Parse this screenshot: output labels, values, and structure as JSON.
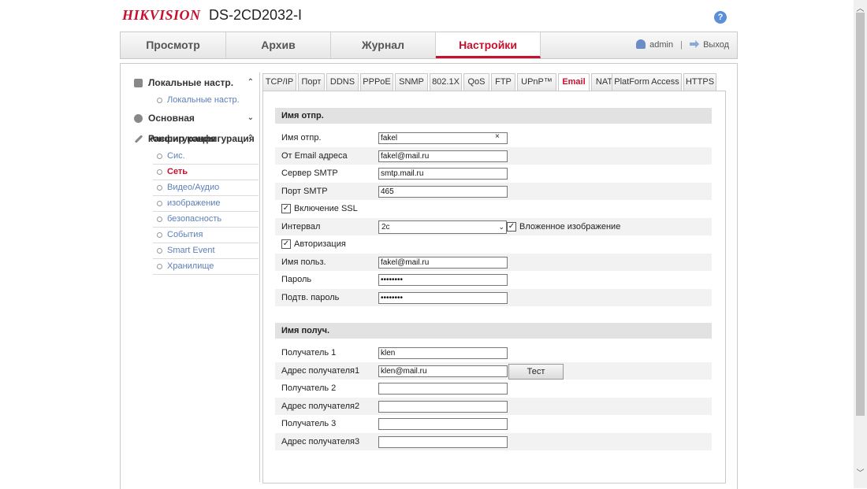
{
  "header": {
    "brand_a": "HIK",
    "brand_b": "VISION",
    "model": "DS-2CD2032-I",
    "help": "?"
  },
  "nav": {
    "tabs": [
      "Просмотр",
      "Архив",
      "Журнал",
      "Настройки"
    ],
    "active": "Настройки",
    "user": "admin",
    "separator": "|",
    "logout": "Выход"
  },
  "sidebar": {
    "local": "Локальные настр.",
    "local_item": "Локальные настр.",
    "basic": "Основная конфигурация",
    "advanced": "Расшир конфигурация",
    "items": [
      "Сис.",
      "Сеть",
      "Видео/Аудио",
      "изображение",
      "безопасность",
      "События",
      "Smart Event",
      "Хранилище"
    ],
    "active_item": "Сеть"
  },
  "tabs": [
    "TCP/IP",
    "Порт",
    "DDNS",
    "PPPoE",
    "SNMP",
    "802.1X",
    "QoS",
    "FTP",
    "UPnP™",
    "Email",
    "NAT",
    "PlatForm Access",
    "HTTPS"
  ],
  "active_tab": "Email",
  "sender": {
    "title": "Имя отпр.",
    "name_label": "Имя отпр.",
    "name_value": "fakel",
    "email_label": "От Email адреса",
    "email_value": "fakel@mail.ru",
    "smtp_label": "Сервер SMTP",
    "smtp_value": "smtp.mail.ru",
    "port_label": "Порт SMTP",
    "port_value": "465",
    "ssl_label": "Включение SSL",
    "interval_label": "Интервал",
    "interval_value": "2с",
    "attach_label": "Вложенное изображение",
    "auth_label": "Авторизация",
    "user_label": "Имя польз.",
    "user_value": "fakel@mail.ru",
    "pass_label": "Пароль",
    "pass_value": "••••••••",
    "confirm_label": "Подтв. пароль",
    "confirm_value": "••••••••"
  },
  "receiver": {
    "title": "Имя получ.",
    "r1_label": "Получатель 1",
    "r1_value": "klen",
    "a1_label": "Адрес получателя1",
    "a1_value": "klen@mail.ru",
    "test": "Тест",
    "r2_label": "Получатель 2",
    "r2_value": "",
    "a2_label": "Адрес получателя2",
    "a2_value": "",
    "r3_label": "Получатель 3",
    "r3_value": "",
    "a3_label": "Адрес получателя3",
    "a3_value": ""
  },
  "check": "✓",
  "clear": "×",
  "chev_up": "⌃",
  "chev_down": "⌄",
  "select_arrow": "⌄",
  "scroll_up": "︿",
  "scroll_down": "﹀"
}
